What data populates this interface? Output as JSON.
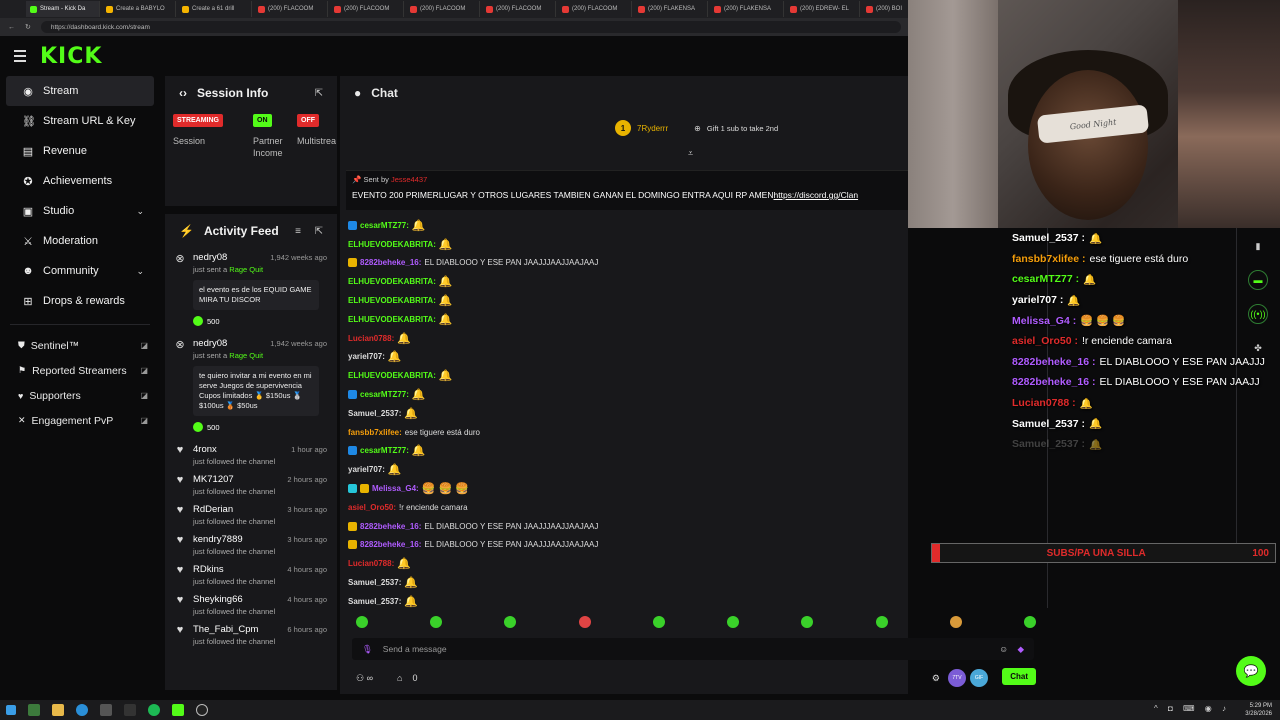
{
  "browser": {
    "tabs": [
      {
        "label": "Stream - Kick Da",
        "type": "kick",
        "active": true
      },
      {
        "label": "Create a BABYLO",
        "type": "k"
      },
      {
        "label": "Create a 61 drill",
        "type": "k"
      },
      {
        "label": "(200) FLACOOM",
        "type": "yt"
      },
      {
        "label": "(200) FLACOOM",
        "type": "yt"
      },
      {
        "label": "(200) FLACOOM",
        "type": "yt"
      },
      {
        "label": "(200) FLACOOM",
        "type": "yt"
      },
      {
        "label": "(200) FLACOOM",
        "type": "yt"
      },
      {
        "label": "(200) FLAKENSA",
        "type": "yt"
      },
      {
        "label": "(200) FLAKENSA",
        "type": "yt"
      },
      {
        "label": "(200) EDREW- EL",
        "type": "yt"
      },
      {
        "label": "(200) BOI",
        "type": "yt"
      }
    ],
    "url": "https://dashboard.kick.com/stream"
  },
  "header": {
    "logo": "KICK"
  },
  "sidebar": {
    "items": [
      {
        "label": "Stream",
        "icon": "broadcast-icon",
        "glyph": "◉",
        "active": true
      },
      {
        "label": "Stream URL & Key",
        "icon": "link-icon",
        "glyph": "⛓"
      },
      {
        "label": "Revenue",
        "icon": "revenue-icon",
        "glyph": "▤"
      },
      {
        "label": "Achievements",
        "icon": "trophy-icon",
        "glyph": "✪"
      },
      {
        "label": "Studio",
        "icon": "studio-icon",
        "glyph": "▣",
        "chevron": true
      },
      {
        "label": "Moderation",
        "icon": "sword-icon",
        "glyph": "⚔"
      },
      {
        "label": "Community",
        "icon": "people-icon",
        "glyph": "☻",
        "chevron": true
      },
      {
        "label": "Drops & rewards",
        "icon": "gift-icon",
        "glyph": "⊞"
      }
    ],
    "extras": [
      {
        "label": "Sentinel™",
        "icon": "shield-icon",
        "glyph": "⛊"
      },
      {
        "label": "Reported Streamers",
        "icon": "flag-icon",
        "glyph": "⚑"
      },
      {
        "label": "Supporters",
        "icon": "heart-icon",
        "glyph": "♥"
      },
      {
        "label": "Engagement PvP",
        "icon": "swords-icon",
        "glyph": "✕"
      }
    ]
  },
  "session": {
    "title": "Session Info",
    "badges": [
      {
        "badge": "STREAMING",
        "color": "red",
        "label": "Session"
      },
      {
        "badge": "ON",
        "color": "green",
        "label": "Partner Income"
      },
      {
        "badge": "OFF",
        "color": "red",
        "label": "Multistrea"
      }
    ]
  },
  "activity": {
    "title": "Activity Feed",
    "items": [
      {
        "type": "kick",
        "name": "nedry08",
        "time": "1,942 weeks ago",
        "sub": "just sent a ",
        "subhl": "Rage Quit",
        "message": "el evento es de los EQUID GAME MIRA TU DISCOR",
        "amount": "500"
      },
      {
        "type": "kick",
        "name": "nedry08",
        "time": "1,942 weeks ago",
        "sub": "just sent a ",
        "subhl": "Rage Quit",
        "message": "te quiero invitar a mi evento en mi serve Juegos de supervivencia Cupos limitados 🥇 $150us 🥈 $100us 🥉 $50us",
        "amount": "500"
      },
      {
        "type": "follow",
        "name": "4ronx",
        "time": "1 hour ago",
        "sub": "just followed the channel"
      },
      {
        "type": "follow",
        "name": "MK71207",
        "time": "2 hours ago",
        "sub": "just followed the channel"
      },
      {
        "type": "follow",
        "name": "RdDerian",
        "time": "3 hours ago",
        "sub": "just followed the channel"
      },
      {
        "type": "follow",
        "name": "kendry7889",
        "time": "3 hours ago",
        "sub": "just followed the channel"
      },
      {
        "type": "follow",
        "name": "RDkins",
        "time": "4 hours ago",
        "sub": "just followed the channel"
      },
      {
        "type": "follow",
        "name": "Sheyking66",
        "time": "4 hours ago",
        "sub": "just followed the channel"
      },
      {
        "type": "follow",
        "name": "The_Fabi_Cpm",
        "time": "6 hours ago",
        "sub": "just followed the channel"
      }
    ]
  },
  "chat": {
    "title": "Chat",
    "gifter": {
      "name": "7Ryderrr",
      "rank": "1",
      "cta": "Gift 1 sub to take 2nd"
    },
    "pinned": {
      "sent_by": "Sent by",
      "sender": "Jesse4437",
      "text": "EVENTO 200 PRIMERLUGAR Y OTROS LUGARES TAMBIEN GANAN EL DOMINGO ENTRA AQUI RP AMEN",
      "link": "https://discord.gg/Clan"
    },
    "messages": [
      {
        "user": "cesarMTZ77:",
        "color": "#53fc18",
        "badges": [
          "#1e88e5"
        ],
        "text": "",
        "emotes": "🔔"
      },
      {
        "user": "ELHUEVODEKABRITA:",
        "color": "#53fc18",
        "badges": [],
        "text": "",
        "emotes": "🔔"
      },
      {
        "user": "8282beheke_16:",
        "color": "#b05cff",
        "badges": [
          "#e8b300"
        ],
        "text": "EL DIABLOOO Y ESE PAN JAAJJJAAJJAAJAAJ",
        "emotes": ""
      },
      {
        "user": "ELHUEVODEKABRITA:",
        "color": "#53fc18",
        "badges": [],
        "text": "",
        "emotes": "🔔"
      },
      {
        "user": "ELHUEVODEKABRITA:",
        "color": "#53fc18",
        "badges": [],
        "text": "",
        "emotes": "🔔"
      },
      {
        "user": "ELHUEVODEKABRITA:",
        "color": "#53fc18",
        "badges": [],
        "text": "",
        "emotes": "🔔"
      },
      {
        "user": "Lucian0788:",
        "color": "#e02b2b",
        "badges": [],
        "text": "",
        "emotes": "🔔"
      },
      {
        "user": "yariel707:",
        "color": "#dddddd",
        "badges": [],
        "text": "",
        "emotes": "🔔"
      },
      {
        "user": "ELHUEVODEKABRITA:",
        "color": "#53fc18",
        "badges": [],
        "text": "",
        "emotes": "🔔"
      },
      {
        "user": "cesarMTZ77:",
        "color": "#53fc18",
        "badges": [
          "#1e88e5"
        ],
        "text": "",
        "emotes": "🔔"
      },
      {
        "user": "Samuel_2537:",
        "color": "#dddddd",
        "badges": [],
        "text": "",
        "emotes": "🔔"
      },
      {
        "user": "fansbb7xlifee:",
        "color": "#f59e0b",
        "badges": [],
        "text": "ese tiguere está duro",
        "emotes": ""
      },
      {
        "user": "cesarMTZ77:",
        "color": "#53fc18",
        "badges": [
          "#1e88e5"
        ],
        "text": "",
        "emotes": "🔔"
      },
      {
        "user": "yariel707:",
        "color": "#dddddd",
        "badges": [],
        "text": "",
        "emotes": "🔔"
      },
      {
        "user": "Melissa_G4:",
        "color": "#b05cff",
        "badges": [
          "#26c6da",
          "#e8b300"
        ],
        "text": "",
        "emotes": "🍔 🍔 🍔"
      },
      {
        "user": "asiel_Oro50:",
        "color": "#e02b2b",
        "badges": [],
        "text": "!r enciende camara",
        "emotes": ""
      },
      {
        "user": "8282beheke_16:",
        "color": "#b05cff",
        "badges": [
          "#e8b300"
        ],
        "text": "EL DIABLOOO Y ESE PAN JAAJJJAAJJAAJAAJ",
        "emotes": ""
      },
      {
        "user": "8282beheke_16:",
        "color": "#b05cff",
        "badges": [
          "#e8b300"
        ],
        "text": "EL DIABLOOO Y ESE PAN JAAJJJAAJJAAJAAJ",
        "emotes": ""
      },
      {
        "user": "Lucian0788:",
        "color": "#e02b2b",
        "badges": [],
        "text": "",
        "emotes": "🔔"
      },
      {
        "user": "Samuel_2537:",
        "color": "#dddddd",
        "badges": [],
        "text": "",
        "emotes": "🔔"
      },
      {
        "user": "Samuel_2537:",
        "color": "#dddddd",
        "badges": [],
        "text": "",
        "emotes": "🔔"
      }
    ],
    "placeholder": "Send a message",
    "viewers": "0",
    "send_label": "Chat"
  },
  "webcam": {
    "band_text": "Good Night"
  },
  "overlay": {
    "messages": [
      {
        "user": "Samuel_2537 :",
        "color": "#ffffff",
        "text": "",
        "emotes": "🔔"
      },
      {
        "user": "fansbb7xlifee :",
        "color": "#f59e0b",
        "text": "ese tiguere está duro",
        "emotes": ""
      },
      {
        "user": "cesarMTZ77 :",
        "color": "#53fc18",
        "text": "",
        "emotes": "🔔"
      },
      {
        "user": "yariel707 :",
        "color": "#ffffff",
        "text": "",
        "emotes": "🔔"
      },
      {
        "user": "Melissa_G4 :",
        "color": "#b05cff",
        "text": "",
        "emotes": "🍔 🍔 🍔"
      },
      {
        "user": "asiel_Oro50 :",
        "color": "#e02b2b",
        "text": "!r enciende camara",
        "emotes": ""
      },
      {
        "user": "8282beheke_16 :",
        "color": "#b05cff",
        "text": "EL DIABLOOO Y ESE PAN JAAJJJ",
        "emotes": ""
      },
      {
        "user": "8282beheke_16 :",
        "color": "#b05cff",
        "text": "EL DIABLOOO Y ESE PAN JAAJJ",
        "emotes": ""
      },
      {
        "user": "Lucian0788 :",
        "color": "#e02b2b",
        "text": "",
        "emotes": "🔔"
      },
      {
        "user": "Samuel_2537 :",
        "color": "#ffffff",
        "text": "",
        "emotes": "🔔"
      },
      {
        "user": "Samuel_2537 :",
        "color": "#777777",
        "text": "",
        "emotes": "🔔"
      }
    ],
    "goal": {
      "label": "SUBS/PA UNA SILLA",
      "value": "100"
    }
  },
  "taskbar": {
    "time": "5:29 PM",
    "date": "3/28/2026"
  }
}
